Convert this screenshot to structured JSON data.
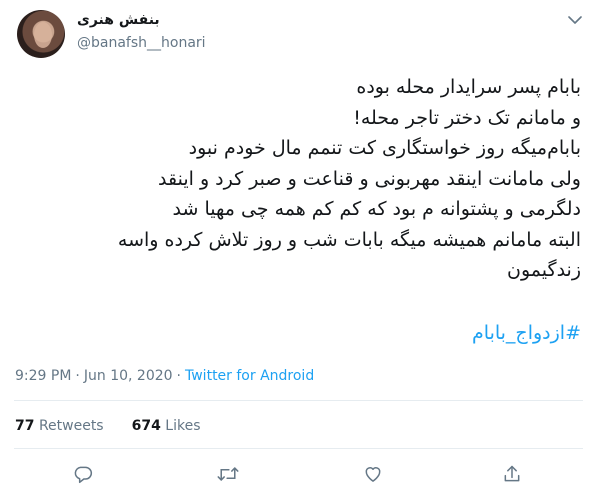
{
  "author": {
    "display_name": "بنفش هنری",
    "handle": "@banafsh__honari"
  },
  "tweet": {
    "lines": [
      "بابام پسر سرایدار محله بوده",
      "و مامانم تک دختر تاجر محله!",
      "بابام‌میگه روز خواستگاری کت تنمم مال خودم نبود",
      "ولی مامانت اینقد مهربونی و قناعت و صبر کرد و اینقد",
      "دلگرمی و پشتوانه م بود که کم کم همه چی مهیا شد",
      "البته مامانم همیشه میگه بابات شب و روز تلاش کرده واسه",
      "زندگیمون"
    ],
    "hashtag": "#ازدواج_بابام"
  },
  "meta": {
    "time": "9:29 PM",
    "separator": "·",
    "date": "Jun 10, 2020",
    "source": "Twitter for Android"
  },
  "stats": {
    "retweets_count": "77",
    "retweets_label": "Retweets",
    "likes_count": "674",
    "likes_label": "Likes"
  },
  "icons": {
    "caret": "chevron-down-icon",
    "reply": "reply-icon",
    "retweet": "retweet-icon",
    "like": "heart-icon",
    "share": "share-icon"
  },
  "colors": {
    "link": "#1da1f2",
    "secondary_text": "#657786",
    "icon": "#657786"
  }
}
